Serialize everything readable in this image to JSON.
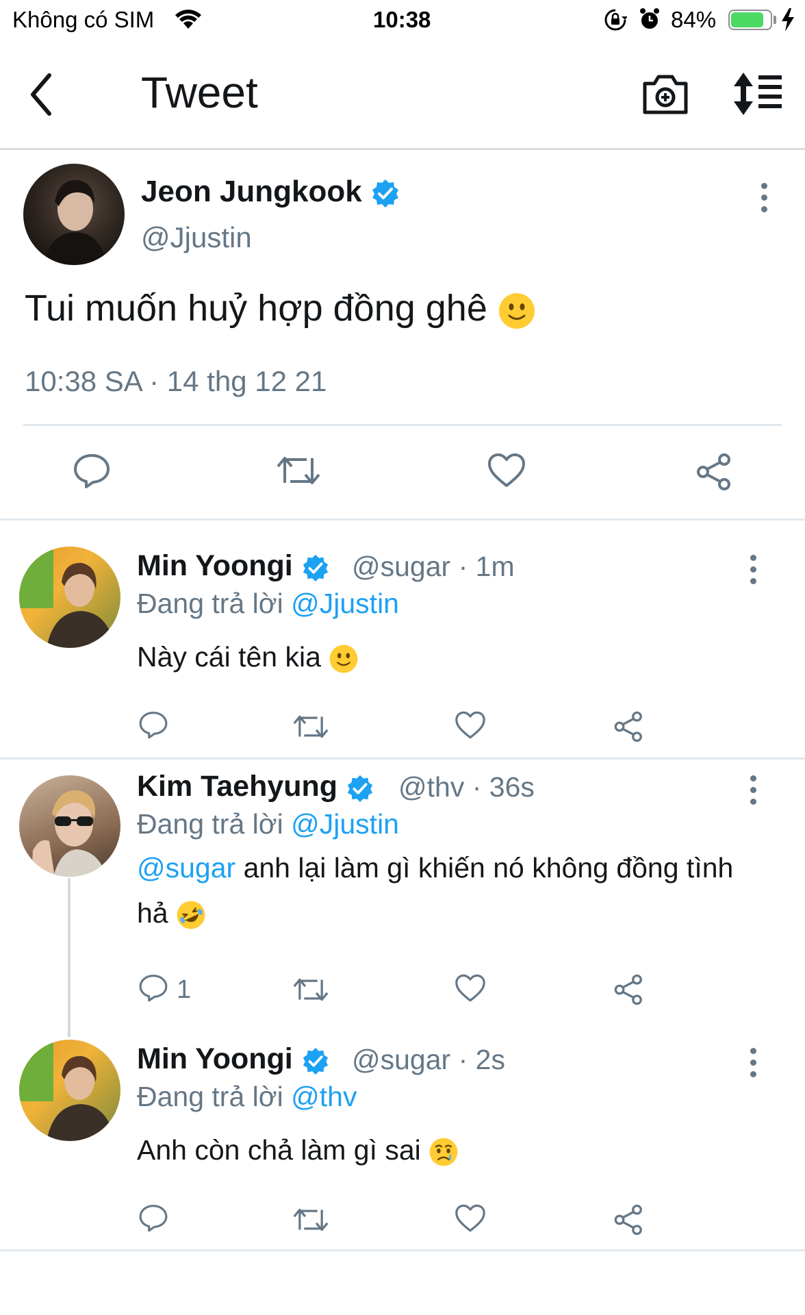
{
  "status_bar": {
    "carrier": "Không có SIM",
    "time": "10:38",
    "battery": "84%",
    "battery_level": 0.84,
    "icons": [
      "wifi-icon",
      "rotation-lock-icon",
      "alarm-icon",
      "battery-icon",
      "charging-bolt-icon"
    ]
  },
  "header": {
    "title": "Tweet",
    "icons": [
      "back-arrow-icon",
      "camera-icon",
      "sort-icon"
    ]
  },
  "main_tweet": {
    "author_name": "Jeon Jungkook",
    "author_handle": "@Jjustin",
    "text": "Tui muốn huỷ hợp đồng ghê",
    "emoji": "slightly-smiling-face",
    "timestamp": "10:38 SA · 14 thg 12 21",
    "actions": [
      "reply-icon",
      "retweet-icon",
      "like-icon",
      "share-icon"
    ]
  },
  "replies": [
    {
      "author_name": "Min Yoongi",
      "author_handle": "@sugar",
      "age": "· 1m",
      "replying_prefix": "Đang trả lời ",
      "replying_to": "@Jjustin",
      "text": "Này cái tên kia",
      "emoji": "slightly-smiling-face",
      "reply_count": ""
    },
    {
      "author_name": "Kim Taehyung",
      "author_handle": "@thv",
      "age": "· 36s",
      "replying_prefix": "Đang trả lời ",
      "replying_to": "@Jjustin",
      "mention": "@sugar",
      "text": " anh lại làm gì khiến nó không đồng tình hả",
      "emoji": "rolling-on-floor-laughing",
      "reply_count": "1"
    },
    {
      "author_name": "Min Yoongi",
      "author_handle": "@sugar",
      "age": "· 2s",
      "replying_prefix": "Đang trả lời ",
      "replying_to": "@thv",
      "text": "Anh còn chả làm gì sai",
      "emoji": "crying-face",
      "reply_count": ""
    }
  ],
  "colors": {
    "accent": "#1da1f2",
    "secondary_text": "#657786",
    "primary_text": "#14171a",
    "divider": "#e1e8ed",
    "battery_fill": "#4cd964"
  }
}
